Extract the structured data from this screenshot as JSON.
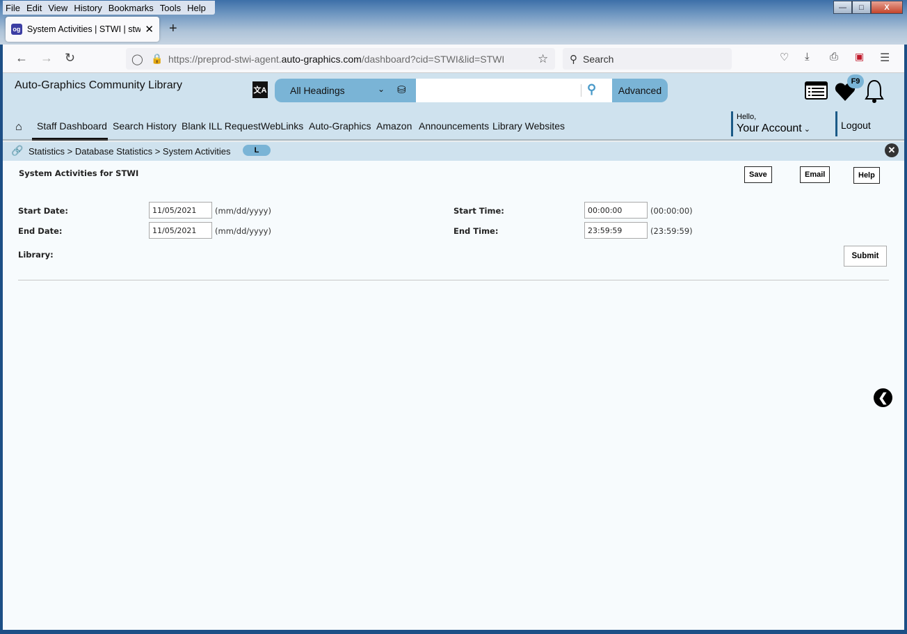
{
  "browser": {
    "menu": [
      "File",
      "Edit",
      "View",
      "History",
      "Bookmarks",
      "Tools",
      "Help"
    ],
    "tab_title": "System Activities | STWI | stwi | Auto-Graphics",
    "url_prefix": "https://preprod-stwi-agent.",
    "url_domain": "auto-graphics.com",
    "url_suffix": "/dashboard?cid=STWI&lid=STWI",
    "search_placeholder": "Search"
  },
  "header": {
    "library_name": "Auto-Graphics Community Library",
    "search_scope": "All Headings",
    "search_value": "",
    "advanced_label": "Advanced",
    "favorites_badge": "F9",
    "hello": "Hello,",
    "account": "Your Account",
    "logout": "Logout"
  },
  "nav": [
    "Staff Dashboard",
    "Search History",
    "Blank ILL Request",
    "WebLinks",
    "Auto-Graphics",
    "Amazon",
    "Announcements",
    "Library Websites"
  ],
  "breadcrumb": {
    "path": "Statistics > Database Statistics > System Activities",
    "pill": "L"
  },
  "form": {
    "title": "System Activities for STWI",
    "save": "Save",
    "email": "Email",
    "help": "Help",
    "start_date_label": "Start Date:",
    "start_date": "11/05/2021",
    "end_date_label": "End Date:",
    "end_date": "11/05/2021",
    "date_hint": "(mm/dd/yyyy)",
    "start_time_label": "Start Time:",
    "start_time": "00:00:00",
    "start_time_hint": "(00:00:00)",
    "end_time_label": "End Time:",
    "end_time": "23:59:59",
    "end_time_hint": "(23:59:59)",
    "library_label": "Library:",
    "submit": "Submit"
  }
}
